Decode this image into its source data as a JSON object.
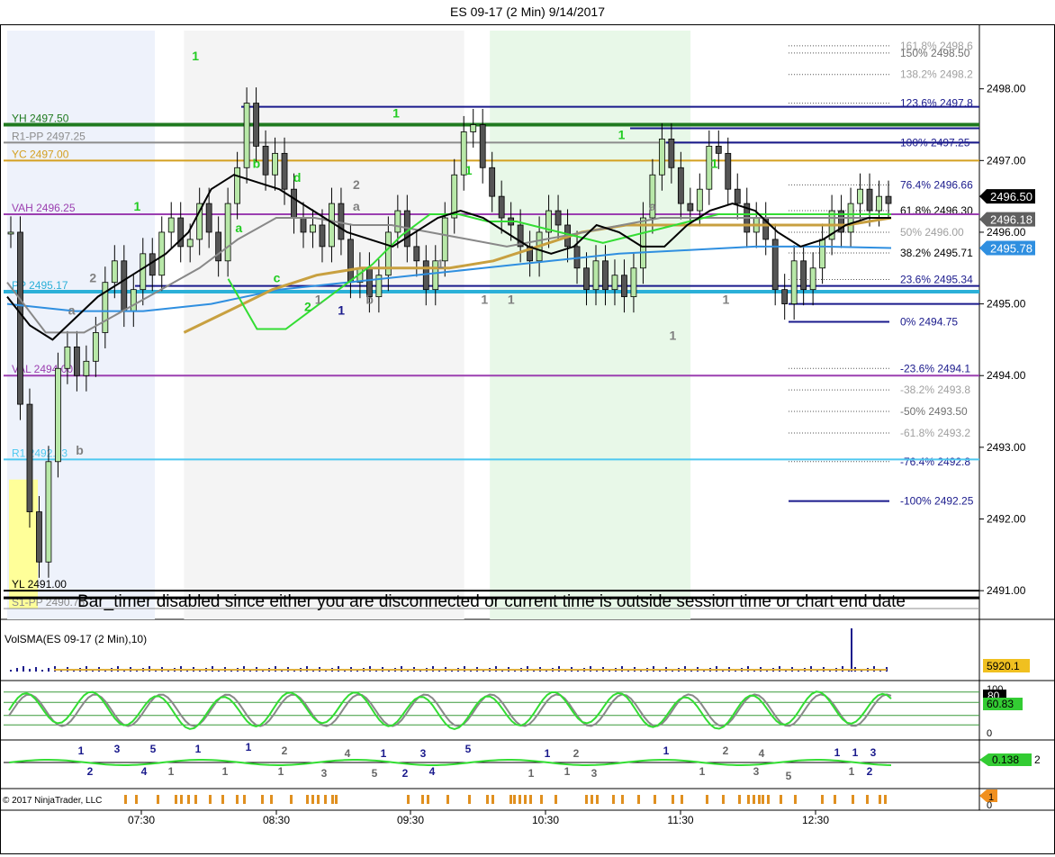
{
  "window": {
    "title": "ES 09-17 (2 Min)  9/14/2017"
  },
  "chart_data": {
    "type": "line",
    "title": "ES 09-17 (2 Min)  9/14/2017",
    "price_axis": {
      "ticks": [
        "2498.00",
        "2497.00",
        "2496.00",
        "2495.00",
        "2494.00",
        "2493.00",
        "2492.00",
        "2491.00"
      ],
      "range": [
        2490.6,
        2498.9
      ]
    },
    "time_axis": {
      "ticks": [
        "07:30",
        "08:30",
        "09:30",
        "10:30",
        "11:30",
        "12:30"
      ]
    },
    "axis_badges": [
      {
        "value": 2496.5,
        "text": "2496.50",
        "bg": "#000000",
        "fg": "#ffffff"
      },
      {
        "value": 2496.18,
        "text": "2496.18",
        "bg": "#606060",
        "fg": "#ffffff"
      },
      {
        "value": 2495.78,
        "text": "2495.78",
        "bg": "#2f8fe0",
        "fg": "#ffffff"
      }
    ],
    "levels": [
      {
        "label": "YH 2497.50",
        "value": 2497.5,
        "color": "#1f7a1f"
      },
      {
        "label": "R1-PP 2497.25",
        "value": 2497.25,
        "color": "#8c8c8c"
      },
      {
        "label": "YC 2497.00",
        "value": 2497.0,
        "color": "#d4a020"
      },
      {
        "label": "VAH 2496.25",
        "value": 2496.25,
        "color": "#9b3fb0"
      },
      {
        "label": "PP 2495.17",
        "value": 2495.17,
        "color": "#2bb0d8"
      },
      {
        "label": "VAL 2494.00",
        "value": 2494.0,
        "color": "#9b3fb0"
      },
      {
        "label": "R1 2492.83",
        "value": 2492.83,
        "color": "#4ec8f0"
      },
      {
        "label": "YL 2491.00",
        "value": 2491.0,
        "color": "#000000"
      },
      {
        "label": "S1-PP 2490.75",
        "value": 2490.75,
        "color": "#8c8c8c"
      }
    ],
    "fib_levels": [
      {
        "label": "161.8%  2498.6",
        "value": 2498.6,
        "color": "#a0a0a0"
      },
      {
        "label": "150%  2498.50",
        "value": 2498.5,
        "color": "#707070"
      },
      {
        "label": "138.2%  2498.2",
        "value": 2498.2,
        "color": "#a0a0a0"
      },
      {
        "label": "123.6%  2497.8",
        "value": 2497.8,
        "color": "#1a1a8c"
      },
      {
        "label": "100%  2497.25",
        "value": 2497.25,
        "color": "#1a1a8c"
      },
      {
        "label": "76.4%  2496.66",
        "value": 2496.66,
        "color": "#1a1a8c"
      },
      {
        "label": "61.8%  2496.30",
        "value": 2496.3,
        "color": "#000000"
      },
      {
        "label": "50%  2496.00",
        "value": 2496.0,
        "color": "#a0a0a0"
      },
      {
        "label": "38.2%  2495.71",
        "value": 2495.71,
        "color": "#000000"
      },
      {
        "label": "23.6%  2495.34",
        "value": 2495.34,
        "color": "#1a1a8c"
      },
      {
        "label": "0%  2494.75",
        "value": 2494.75,
        "color": "#1a1a8c"
      },
      {
        "label": "-23.6%  2494.1",
        "value": 2494.1,
        "color": "#1a1a8c"
      },
      {
        "label": "-38.2%  2493.8",
        "value": 2493.8,
        "color": "#a0a0a0"
      },
      {
        "label": "-50%  2493.50",
        "value": 2493.5,
        "color": "#707070"
      },
      {
        "label": "-61.8%  2493.2",
        "value": 2493.2,
        "color": "#a0a0a0"
      },
      {
        "label": "-76.4%  2492.8",
        "value": 2492.8,
        "color": "#1a1a8c"
      },
      {
        "label": "-100%  2492.25",
        "value": 2492.25,
        "color": "#1a1a8c"
      }
    ],
    "sessions": [
      {
        "from": 0.0,
        "to": 0.167,
        "color": "#eef2fb"
      },
      {
        "from": 0.2,
        "to": 0.517,
        "color": "#f4f4f4"
      },
      {
        "from": 0.546,
        "to": 0.773,
        "color": "#e8f8e8"
      }
    ],
    "price_series": [
      2496.0,
      2493.6,
      2492.1,
      2491.4,
      2492.8,
      2494.1,
      2494.4,
      2494.0,
      2494.2,
      2494.6,
      2495.3,
      2495.6,
      2494.9,
      2495.2,
      2495.7,
      2495.4,
      2496.0,
      2496.2,
      2495.8,
      2495.9,
      2496.4,
      2496.0,
      2495.6,
      2496.4,
      2496.9,
      2497.8,
      2497.2,
      2496.8,
      2497.1,
      2496.6,
      2496.2,
      2496.0,
      2496.1,
      2495.8,
      2496.4,
      2495.9,
      2495.3,
      2495.5,
      2495.1,
      2495.4,
      2496.0,
      2496.3,
      2495.8,
      2495.6,
      2495.2,
      2495.6,
      2496.2,
      2496.8,
      2497.4,
      2497.5,
      2496.9,
      2496.5,
      2496.2,
      2496.1,
      2495.8,
      2495.6,
      2496.0,
      2496.3,
      2496.1,
      2495.8,
      2495.5,
      2495.2,
      2495.6,
      2495.2,
      2495.4,
      2495.1,
      2495.5,
      2496.2,
      2496.8,
      2497.3,
      2496.9,
      2496.4,
      2496.3,
      2496.6,
      2497.2,
      2497.1,
      2496.6,
      2496.4,
      2496.0,
      2496.2,
      2495.9,
      2495.2,
      2495.0,
      2495.6,
      2495.2,
      2495.5,
      2495.9,
      2496.3,
      2496.0,
      2496.4,
      2496.6,
      2496.3,
      2496.5,
      2496.4
    ],
    "sma_fast": [
      2495.1,
      2494.7,
      2494.5,
      2494.8,
      2495.1,
      2495.3,
      2495.5,
      2495.7,
      2496.0,
      2496.6,
      2496.8,
      2496.7,
      2496.6,
      2496.4,
      2496.2,
      2496.0,
      2495.9,
      2495.8,
      2496.0,
      2496.2,
      2496.3,
      2496.2,
      2496.0,
      2495.8,
      2495.7,
      2495.8,
      2496.1,
      2496.0,
      2495.8,
      2495.8,
      2496.1,
      2496.3,
      2496.4,
      2496.3,
      2496.0,
      2495.8,
      2495.9,
      2496.1,
      2496.2,
      2496.2
    ],
    "sma_mid": [
      2495.3,
      2494.6,
      2494.6,
      2494.9,
      2495.2,
      2495.5,
      2495.9,
      2496.2,
      2496.2,
      2496.1,
      2496.1,
      2496.0,
      2495.9,
      2495.8,
      2495.9,
      2496.0,
      2496.1,
      2496.2,
      2496.2,
      2496.2,
      2496.2,
      2496.2,
      2496.2,
      2496.2
    ],
    "sma_slow": [
      2494.6,
      2494.9,
      2495.2,
      2495.4,
      2495.5,
      2495.5,
      2495.5,
      2495.6,
      2495.8,
      2496.0,
      2496.1,
      2496.1,
      2496.1,
      2496.1,
      2496.1,
      2496.1,
      2496.2
    ],
    "sma_base": [
      2495.0,
      2494.9,
      2494.9,
      2495.0,
      2495.2,
      2495.3,
      2495.4,
      2495.5,
      2495.6,
      2495.7,
      2495.75,
      2495.8,
      2495.8,
      2495.78
    ],
    "swing_labels": [
      {
        "text": "1",
        "x": 0.213,
        "y": 2498.4,
        "color": "#22cc22"
      },
      {
        "text": "b",
        "x": 0.282,
        "y": 2496.9,
        "color": "#22cc22"
      },
      {
        "text": "d",
        "x": 0.328,
        "y": 2496.7,
        "color": "#22cc22"
      },
      {
        "text": "a",
        "x": 0.262,
        "y": 2496.0,
        "color": "#22cc22"
      },
      {
        "text": "1",
        "x": 0.147,
        "y": 2496.3,
        "color": "#22cc22"
      },
      {
        "text": "c",
        "x": 0.305,
        "y": 2495.3,
        "color": "#22cc22"
      },
      {
        "text": "2",
        "x": 0.34,
        "y": 2494.9,
        "color": "#22cc22"
      },
      {
        "text": "1",
        "x": 0.44,
        "y": 2497.6,
        "color": "#22cc22"
      },
      {
        "text": "1",
        "x": 0.522,
        "y": 2496.8,
        "color": "#22cc22"
      },
      {
        "text": "1",
        "x": 0.695,
        "y": 2497.3,
        "color": "#22cc22"
      },
      {
        "text": "1",
        "x": 0.8,
        "y": 2496.9,
        "color": "#22cc22"
      },
      {
        "text": "2",
        "x": 0.395,
        "y": 2496.6,
        "color": "#808080"
      },
      {
        "text": "a",
        "x": 0.395,
        "y": 2496.3,
        "color": "#808080"
      },
      {
        "text": "b",
        "x": 0.41,
        "y": 2495.0,
        "color": "#808080"
      },
      {
        "text": "1",
        "x": 0.352,
        "y": 2495.0,
        "color": "#808080"
      },
      {
        "text": "1",
        "x": 0.378,
        "y": 2494.85,
        "color": "#1a1a8c"
      },
      {
        "text": "1",
        "x": 0.49,
        "y": 2495.5,
        "color": "#808080"
      },
      {
        "text": "1",
        "x": 0.54,
        "y": 2495.0,
        "color": "#808080"
      },
      {
        "text": "1",
        "x": 0.57,
        "y": 2495.0,
        "color": "#808080"
      },
      {
        "text": "a",
        "x": 0.73,
        "y": 2496.3,
        "color": "#808080"
      },
      {
        "text": "1",
        "x": 0.753,
        "y": 2494.5,
        "color": "#808080"
      },
      {
        "text": "1",
        "x": 0.813,
        "y": 2495.0,
        "color": "#808080"
      },
      {
        "text": "2",
        "x": 0.097,
        "y": 2495.3,
        "color": "#808080"
      },
      {
        "text": "a",
        "x": 0.073,
        "y": 2494.85,
        "color": "#808080"
      },
      {
        "text": "b",
        "x": 0.082,
        "y": 2492.9,
        "color": "#808080"
      }
    ],
    "notice": "Bar_timer disabled since either you are disconnected or current time is outside session time or chart end date",
    "volume_panel": {
      "label": "VolSMA(ES 09-17 (2 Min),10)",
      "badge": "5920.1"
    },
    "stoch_panel": {
      "ticks": [
        "100",
        "0"
      ],
      "badges": [
        "80",
        "60.83"
      ]
    },
    "wave_panel": {
      "badge": "0.138",
      "extra": "2"
    },
    "marker_panel": {
      "copyright": "© 2017 NinjaTrader, LLC",
      "badge": "1",
      "zero": "0"
    }
  }
}
